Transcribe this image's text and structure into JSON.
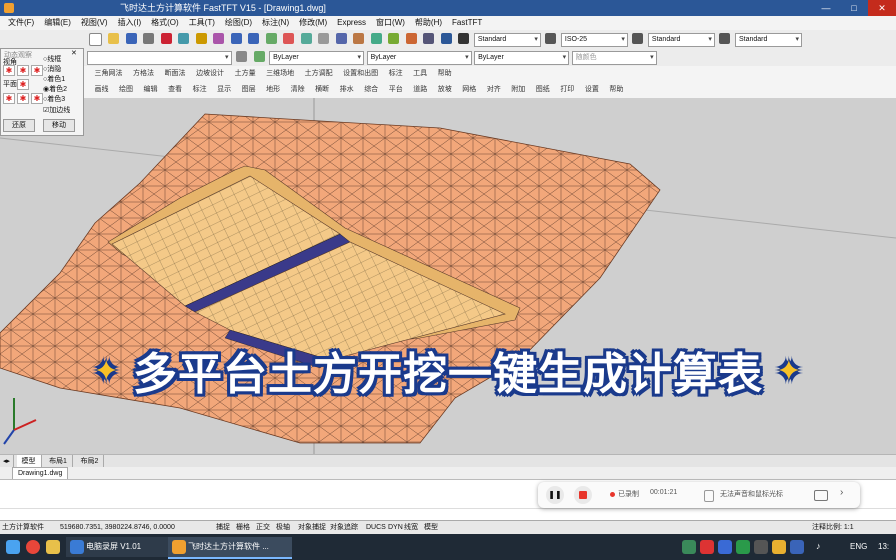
{
  "window": {
    "title": "飞时达土方计算软件 FastTFT V15 - [Drawing1.dwg]",
    "minimize": "—",
    "maximize": "□",
    "close": "✕"
  },
  "menu": [
    "文件(F)",
    "编辑(E)",
    "视图(V)",
    "插入(I)",
    "格式(O)",
    "工具(T)",
    "绘图(D)",
    "标注(N)",
    "修改(M)",
    "Express",
    "窗口(W)",
    "帮助(H)",
    "FastTFT"
  ],
  "toolbar": {
    "text_style": "Standard",
    "dim_style": "ISO-25",
    "table_style": "Standard",
    "ml_style": "Standard",
    "layer_color": "ByLayer",
    "linetype": "ByLayer",
    "lineweight": "ByLayer",
    "plot_style": "随颜色"
  },
  "ribbon_tabs": [
    "三角网法",
    "方格法",
    "断面法",
    "边坡设计",
    "土方量",
    "三维场地",
    "土方调配",
    "设置和出图",
    "标注",
    "工具",
    "帮助"
  ],
  "ribbon_tools": [
    "画线",
    "绘图",
    "编辑",
    "查看",
    "标注",
    "显示",
    "图层",
    "地形",
    "清除",
    "横断",
    "排水",
    "综合",
    "平台",
    "道路",
    "放坡",
    "网格",
    "对齐",
    "附加",
    "图纸",
    "打印",
    "设置",
    "帮助"
  ],
  "panel": {
    "title": "动态观察",
    "view_label": "视角",
    "top_label": "平面",
    "options": [
      "线框",
      "消隐",
      "着色1",
      "着色2",
      "着色3"
    ],
    "checkbox": "加边线",
    "btn_left": "还原",
    "btn_right": "移动"
  },
  "overlay": {
    "star_left": "✦",
    "text": "多平台土方开挖一键生成计算表",
    "star_right": "✦"
  },
  "layout_tabs": [
    "模型",
    "布局1",
    "布局2"
  ],
  "doc_tab": "Drawing1.dwg",
  "recorder": {
    "pause": "❚❚",
    "label": "已录制",
    "time": "00:01:21",
    "hint": "无法声音和鼠标光标"
  },
  "status": {
    "app": "土方计算软件",
    "coords": "519680.7351, 3980224.8746, 0.0000",
    "toggles": [
      "捕捉",
      "栅格",
      "正交",
      "极轴",
      "对象捕捉",
      "对象追踪",
      "DUCS",
      "DYN",
      "线宽",
      "模型"
    ],
    "scale": "注释比例: 1:1"
  },
  "taskbar": {
    "app1": "电脑录屏 V1.01",
    "app2": "飞时达土方计算软件 ...",
    "lang": "ENG",
    "clock": "13:"
  }
}
